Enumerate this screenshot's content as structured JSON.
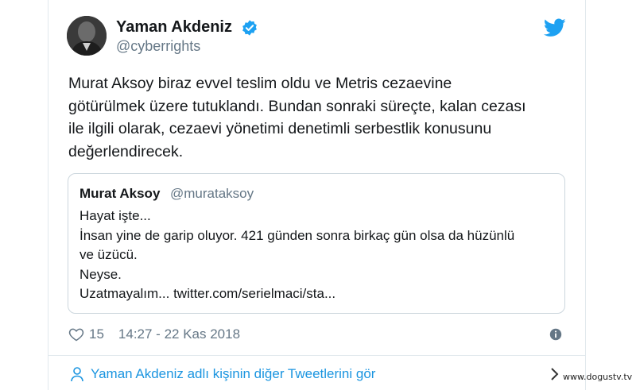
{
  "tweet": {
    "author_name": "Yaman Akdeniz",
    "author_handle": "@cyberrights",
    "text_lines": [
      "Murat Aksoy biraz evvel teslim oldu ve Metris cezaevine",
      "götürülmek üzere tutuklandı. Bundan sonraki süreçte, kalan cezası",
      "ile ilgili olarak, cezaevi yönetimi denetimli serbestlik konusunu",
      "değerlendirecek."
    ],
    "likes": "15",
    "timestamp": "14:27 - 22 Kas 2018"
  },
  "quoted": {
    "author_name": "Murat Aksoy",
    "author_handle": "@murataksoy",
    "text_lines": [
      "Hayat işte...",
      "İnsan yine de garip oluyor. 421 günden sonra birkaç gün olsa da hüzünlü",
      "ve üzücü.",
      "Neyse.",
      "Uzatmayalım... twitter.com/serielmaci/sta..."
    ]
  },
  "footer": {
    "more_tweets_label": "Yaman Akdeniz adlı kişinin diğer Tweetlerini gör"
  },
  "watermark": "www.dogustv.tv",
  "colors": {
    "link": "#1b95e0",
    "verified": "#1da1f2",
    "secondary_text": "#657786",
    "border": "#ccd6dd"
  },
  "icons": {
    "verified": "verified-badge-icon",
    "brand": "twitter-bird-icon",
    "like": "heart-icon",
    "info": "info-icon",
    "profile": "person-icon",
    "more": "chevron-right-icon"
  }
}
